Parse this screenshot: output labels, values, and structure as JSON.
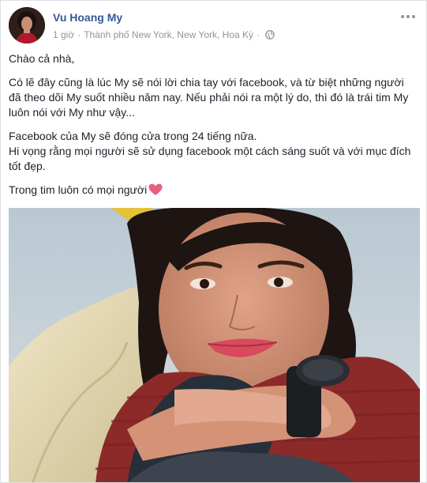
{
  "post": {
    "author": "Vu Hoang My",
    "time": "1 giờ",
    "location": "Thành phố New York, New York, Hoa Kỳ",
    "privacy_icon": "globe-icon",
    "menu_icon": "more-options-icon",
    "paragraphs": [
      "Chào cả nhà,",
      "Có lẽ đây cũng là lúc My sẽ nói lời chia tay với facebook, và từ biệt những người đã theo dõi My suốt nhiều năm nay. Nếu phải nói ra một lý do, thì đó là trái tim My luôn nói với My như vậy...",
      "Facebook của My sẽ đóng cửa trong 24 tiếng nữa.",
      "Hi vọng rằng mọi người sẽ sử dụng facebook một cách sáng suốt và với mục đích tốt đẹp.",
      "Trong tim luôn có mọi người"
    ],
    "emoji": "heart-emoji-icon"
  },
  "colors": {
    "link": "#365899",
    "meta": "#90949c",
    "text": "#1d2129",
    "heart": "#e8607f"
  }
}
